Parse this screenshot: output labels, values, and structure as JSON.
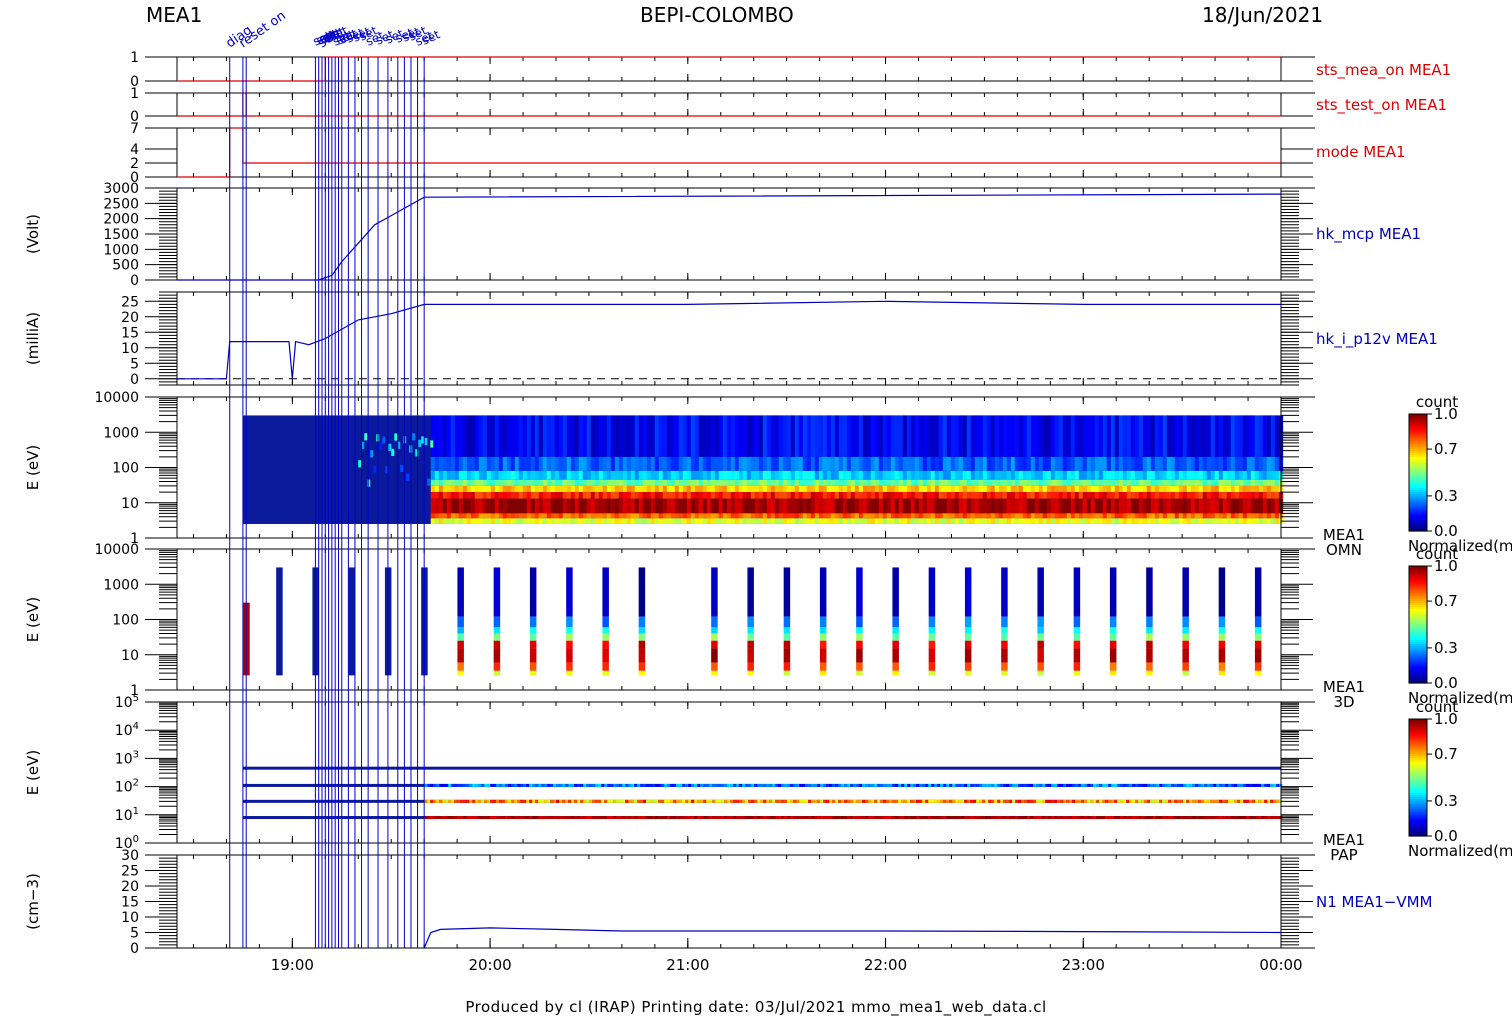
{
  "header": {
    "instrument": "MEA1",
    "mission": "BEPI-COLOMBO",
    "date": "18/Jun/2021"
  },
  "footer": {
    "text": "Produced by cl (IRAP)    Printing date: 03/Jul/2021    mmo_mea1_web_data.cl"
  },
  "colors": {
    "status_line": "#dd0000",
    "hk_line": "#0000bb",
    "event_line": "#0000cc"
  },
  "chart_data": [
    {
      "type": "line",
      "name": "sts_mea_on MEA1",
      "label": "sts_mea_on MEA1",
      "ylabel": "",
      "yticks": [
        "1",
        "0"
      ],
      "ylim": [
        0,
        1
      ],
      "x": [
        "18:25",
        "19:10",
        "19:10",
        "00:00"
      ],
      "y": [
        0,
        0,
        1,
        1
      ]
    },
    {
      "type": "line",
      "name": "sts_test_on MEA1",
      "label": "sts_test_on MEA1",
      "ylabel": "",
      "yticks": [
        "1",
        "0"
      ],
      "ylim": [
        0,
        1
      ],
      "x": [
        "18:25",
        "18:45",
        "18:45",
        "18:46",
        "18:46",
        "00:00"
      ],
      "y": [
        0,
        0,
        1,
        1,
        0,
        0
      ]
    },
    {
      "type": "line",
      "name": "mode MEA1",
      "label": "mode MEA1",
      "ylabel": "",
      "yticks": [
        "7",
        "4",
        "2",
        "0"
      ],
      "ylim": [
        0,
        7
      ],
      "x": [
        "18:25",
        "18:41",
        "18:41",
        "18:45",
        "18:45",
        "00:00"
      ],
      "y": [
        0,
        0,
        7,
        7,
        2,
        2
      ]
    },
    {
      "type": "line",
      "name": "hk_mcp MEA1",
      "label": "hk_mcp MEA1",
      "ylabel": "(Volt)",
      "yticks": [
        "3000",
        "2500",
        "2000",
        "1500",
        "1000",
        "500",
        "0"
      ],
      "ylim": [
        0,
        3000
      ],
      "x": [
        "18:25",
        "19:08",
        "19:12",
        "19:15",
        "19:20",
        "19:25",
        "19:30",
        "19:35",
        "19:40",
        "00:00"
      ],
      "y": [
        0,
        0,
        150,
        600,
        1200,
        1800,
        2100,
        2400,
        2700,
        2800
      ]
    },
    {
      "type": "line",
      "name": "hk_i_p12v MEA1",
      "label": "hk_i_p12v MEA1",
      "ylabel": "(milliA)",
      "yticks": [
        "25",
        "20",
        "15",
        "10",
        "5",
        "0"
      ],
      "ylim": [
        -2,
        28
      ],
      "x": [
        "18:25",
        "18:40",
        "18:41",
        "18:50",
        "18:59",
        "19:00",
        "19:01",
        "19:05",
        "19:10",
        "19:20",
        "19:30",
        "19:40",
        "20:00",
        "21:00",
        "22:00",
        "23:00",
        "00:00"
      ],
      "y": [
        0,
        0,
        12,
        12,
        12,
        0,
        12,
        11,
        13,
        19,
        21,
        24,
        24,
        24,
        25,
        24,
        24
      ]
    },
    {
      "type": "heatmap",
      "name": "MEA1 OMN",
      "label": "MEA1 OMN",
      "ylabel": "E (eV)",
      "yticks": [
        "10000",
        "1000",
        "100",
        "10",
        "1"
      ],
      "ylim": [
        1,
        10000
      ],
      "colorbar": {
        "title": "count",
        "ticks": [
          "1.0",
          "0.7",
          "0.3",
          "0.0"
        ],
        "caption": "Normalized(m"
      },
      "x_start": "18:45",
      "x_end": "00:00",
      "description_energy_peak_eV": 8
    },
    {
      "type": "heatmap",
      "name": "MEA1 3D",
      "label": "MEA1 3D",
      "ylabel": "E (eV)",
      "yticks": [
        "10000",
        "1000",
        "100",
        "10",
        "1"
      ],
      "ylim": [
        1,
        10000
      ],
      "colorbar": {
        "title": "count",
        "ticks": [
          "1.0",
          "0.7",
          "0.3",
          "0.0"
        ],
        "caption": "Normalized(m"
      },
      "x": [
        "18:46",
        "18:56",
        "19:07",
        "19:18",
        "19:29",
        "19:40",
        "19:51",
        "20:02",
        "20:13",
        "20:24",
        "20:35",
        "20:46",
        "21:08",
        "21:19",
        "21:30",
        "21:41",
        "21:52",
        "22:03",
        "22:14",
        "22:25",
        "22:36",
        "22:47",
        "22:58",
        "23:09",
        "23:20",
        "23:31",
        "23:42",
        "23:53"
      ]
    },
    {
      "type": "heatmap",
      "name": "MEA1 PAP",
      "label": "MEA1 PAP",
      "ylabel": "E (eV)",
      "yticks": [
        "10^5",
        "10^4",
        "10^3",
        "10^2",
        "10^1",
        "10^0"
      ],
      "ylim": [
        1,
        100000
      ],
      "colorbar": {
        "title": "count",
        "ticks": [
          "1.0",
          "0.7",
          "0.3",
          "0.0"
        ],
        "caption": "Normalized(m"
      },
      "bands_eV": [
        450,
        110,
        30,
        8
      ]
    },
    {
      "type": "line",
      "name": "N1 MEA1-VMM",
      "label": "N1 MEA1−VMM",
      "ylabel": "(cm−3)",
      "yticks": [
        "30",
        "25",
        "20",
        "15",
        "10",
        "5",
        "0"
      ],
      "ylim": [
        0,
        30
      ],
      "x": [
        "19:40",
        "19:42",
        "19:45",
        "20:00",
        "20:20",
        "20:40",
        "21:00",
        "22:00",
        "23:00",
        "00:00"
      ],
      "y": [
        0,
        5,
        6,
        6.5,
        6,
        5.5,
        5.5,
        5.5,
        5.3,
        5
      ]
    }
  ],
  "x_axis": {
    "ticks": [
      "19:00",
      "20:00",
      "21:00",
      "22:00",
      "23:00",
      "00:00"
    ],
    "start": "18:25",
    "end": "00:00"
  },
  "event_markers": {
    "times": [
      "18:41",
      "18:45",
      "18:46",
      "19:07",
      "19:08",
      "19:09",
      "19:10",
      "19:11",
      "19:12",
      "19:13",
      "19:14",
      "19:15",
      "19:17",
      "19:19",
      "19:21",
      "19:23",
      "19:26",
      "19:29",
      "19:32",
      "19:34",
      "19:36",
      "19:38",
      "19:40"
    ],
    "labels": [
      "diag",
      "reset on",
      "set"
    ]
  }
}
